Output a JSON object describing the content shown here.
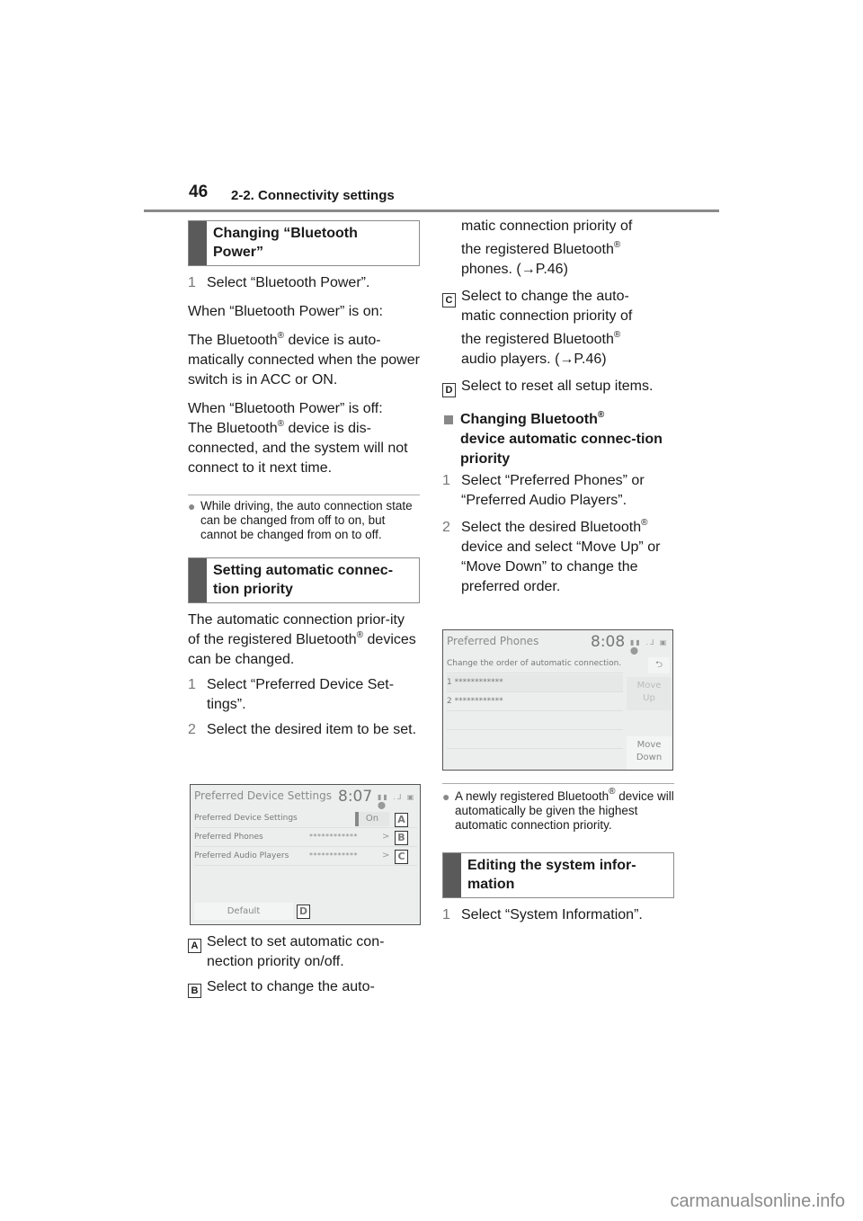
{
  "header": {
    "page_number": "46",
    "section": "2-2. Connectivity settings"
  },
  "left": {
    "heading1": [
      "Changing “Bluetooth",
      "Power”"
    ],
    "step1": {
      "n": "1",
      "text": "Select “Bluetooth Power”."
    },
    "on_title": "When “Bluetooth Power” is on:",
    "on_text_a": "The Bluetooth",
    "on_text_b": " device is auto-matically connected when the power switch is in ACC or ON.",
    "off_title": "When “Bluetooth Power” is off:",
    "off_text_a": "The Bluetooth",
    "off_text_b": " device is dis-connected, and the system will not connect to it next time.",
    "note": "While driving, the auto connection state can be changed from off to on, but cannot be changed from on to off.",
    "heading2": [
      "Setting automatic connec-",
      "tion priority"
    ],
    "intro_a": "The automatic connection prior-ity of the registered Bluetooth",
    "intro_b": "devices can be changed.",
    "steps": [
      {
        "n": "1",
        "text": "Select “Preferred Device Set-tings”."
      },
      {
        "n": "2",
        "text": "Select the desired item to be set."
      }
    ],
    "labelA": {
      "label": "A",
      "text": "Select to set automatic con-nection priority on/off."
    },
    "labelB": {
      "label": "B",
      "text": "Select to change the auto-"
    }
  },
  "screen1": {
    "title": "Preferred Device Settings",
    "time": "8:07",
    "status": "▮▮ .⅃ ▣ ⬤",
    "rows": [
      {
        "label": "Preferred Device Settings",
        "value": "On",
        "callout": "A"
      },
      {
        "label": "Preferred Phones",
        "value": "************",
        "callout": "B"
      },
      {
        "label": "Preferred Audio Players",
        "value": "************",
        "callout": "C"
      }
    ],
    "default_button": "Default",
    "default_callout": "D",
    "chevron": ">"
  },
  "right": {
    "cont_a": "matic connection priority of",
    "cont_b": "the registered Bluetooth",
    "cont_c": "phones. (→P.46)",
    "labelC": {
      "label": "C",
      "a": "Select to change the auto-",
      "b": "matic connection priority of",
      "c": "the registered Bluetooth",
      "d": "audio players. (→P.46)"
    },
    "labelD": {
      "label": "D",
      "text": "Select to reset all setup items."
    },
    "subhead_a": "Changing Bluetooth",
    "subhead_b": "device automatic connec-tion priority",
    "steps": [
      {
        "n": "1",
        "text": "Select “Preferred Phones” or “Preferred Audio Players”."
      },
      {
        "n": "2",
        "text_a": "Select the desired Bluetooth",
        "text_b": "device and select “Move Up” or “Move Down” to change the preferred order."
      }
    ],
    "note_a": "A newly registered Bluetooth",
    "note_b": "device will automatically be given the highest automatic connection priority.",
    "heading3": [
      "Editing the system infor-",
      "mation"
    ],
    "step_final": {
      "n": "1",
      "text": "Select “System Information”."
    }
  },
  "screen2": {
    "title": "Preferred Phones",
    "time": "8:08",
    "status": "▮▮ .⅃ ▣ ⬤",
    "subtitle": "Change the order of automatic connection.",
    "devices": [
      {
        "n": "1",
        "name": "************"
      },
      {
        "n": "2",
        "name": "************"
      }
    ],
    "back_icon": "⮌",
    "move_up": [
      "Move",
      "Up"
    ],
    "move_down": [
      "Move",
      "Down"
    ]
  },
  "reg": "®",
  "bullet": "●",
  "watermark": "carmanualsonline.info"
}
